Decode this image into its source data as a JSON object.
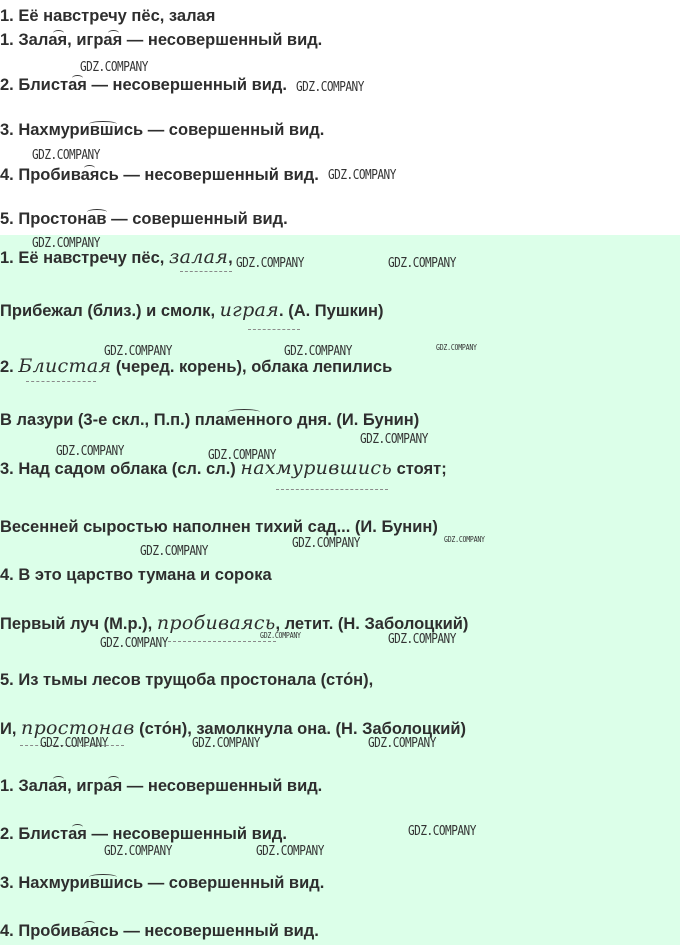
{
  "top_lines": [
    "1. Её навстречу пёс, залая",
    "1. Залая, играя — несовершенный вид.",
    "2. Блистая — несовершенный вид.",
    "3. Нахмурившись — совершенный вид.",
    "4. Пробиваясь — несовершенный вид.",
    "5. Простонав — совершенный вид."
  ],
  "bottom_lines": {
    "l1_a": "1. Её навстречу пёс,",
    "l1_b": "залая",
    "l1_c": ",",
    "l2_a": "Прибежал (близ.) и смолк,",
    "l2_b": "играя",
    "l2_c": ". (А. Пушкин)",
    "l3_a": "2.",
    "l3_b": "Блистая",
    "l3_c": " (черед. корень), облака лепились",
    "l4": "В лазури (3-е скл., П.п.) пламенного дня. (И. Бунин)",
    "l5_a": "3. Над садом облака (сл. сл.)",
    "l5_b": "нахмурившись",
    "l5_c": " стоят;",
    "l6": "Весенней сыростью наполнен тихий сад... (И. Бунин)",
    "l7": "4. В это царство тумана и сорока",
    "l8_a": "Первый луч (М.р.),",
    "l8_b": "пробиваясь",
    "l8_c": ", летит. (Н. Заболоцкий)",
    "l9": "5. Из тьмы лесов трущоба простонала (сто́н),",
    "l10_a": "И,",
    "l10_b": "простонав",
    "l10_c": " (сто́н), замолкнула она. (Н. Заболоцкий)",
    "l11": "1. Залая, играя — несовершенный вид.",
    "l12": "2. Блистая — несовершенный вид.",
    "l13": "3. Нахмурившись — совершенный вид.",
    "l14": "4. Пробиваясь — несовершенный вид."
  },
  "watermark": "GDZ.COMPANY",
  "colors": {
    "background_top": "#ffffff",
    "background_bottom": "#dcffe9",
    "text": "#2e2e2e"
  }
}
